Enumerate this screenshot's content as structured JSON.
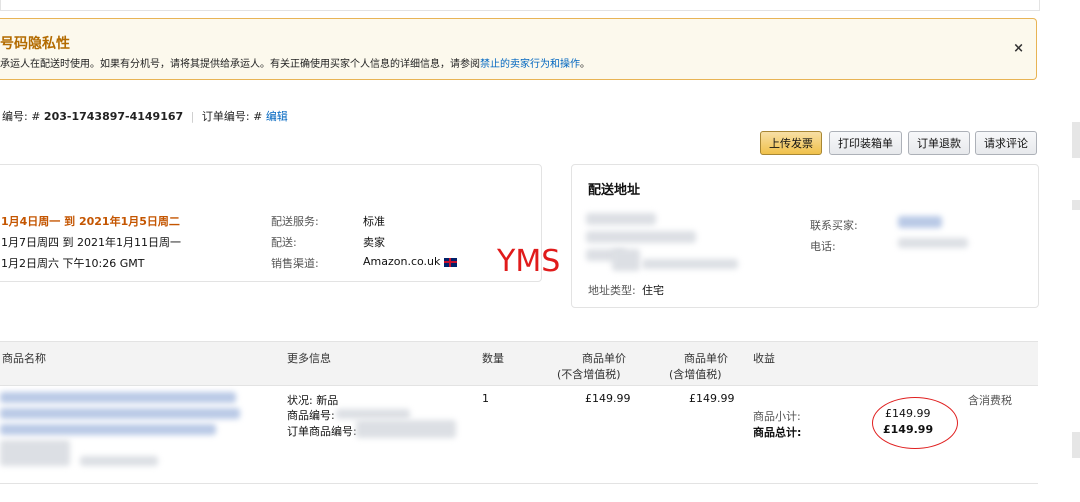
{
  "alert": {
    "title": "号码隐私性",
    "text_before": "承运人在配送时使用。如果有分机号，请将其提供给承运人。有关正确使用买家个人信息的详细信息，请参阅",
    "link": "禁止的卖家行为和操作",
    "text_after": "。",
    "close": "×"
  },
  "order": {
    "id_label": "编号: #",
    "id": "203-1743897-4149167",
    "order_no_label": "订单编号: #",
    "edit": "编辑"
  },
  "actions": {
    "upload_invoice": "上传发票",
    "print_packing": "打印装箱单",
    "refund": "订单退款",
    "request_review": "请求评论"
  },
  "summary": {
    "delivery_range": "1月4日周一 到 2021年1月5日周二",
    "ship_range": "1月7日周四 到 2021年1月11日周一",
    "purchase_date": "1月2日周六 下午10:26 GMT",
    "service_label": "配送服务:",
    "service": "标准",
    "fulfillment_label": "配送:",
    "fulfillment": "卖家",
    "channel_label": "销售渠道:",
    "channel": "Amazon.co.uk",
    "channel_flag": "🇬🇧"
  },
  "shipping": {
    "title": "配送地址",
    "address_type_label": "地址类型:",
    "address_type": "住宅",
    "contact_label": "联系买家:",
    "phone_label": "电话:"
  },
  "watermark": "YMS",
  "table": {
    "headers": {
      "name": "商品名称",
      "more": "更多信息",
      "qty": "数量",
      "price_ex": "商品单价",
      "price_ex_sub": "(不含增值税)",
      "price_inc": "商品单价",
      "price_inc_sub": "(含增值税)",
      "income": "收益"
    },
    "row": {
      "condition_label": "状况: 新品",
      "sku_label": "商品编号:",
      "order_item_label": "订单商品编号:",
      "qty": "1",
      "price_ex": "£149.99",
      "price_inc": "£149.99",
      "subtotal_label": "商品小计:",
      "subtotal": "£149.99",
      "total_label": "商品总计:",
      "total": "£149.99",
      "tax_note": "含消费税"
    }
  }
}
